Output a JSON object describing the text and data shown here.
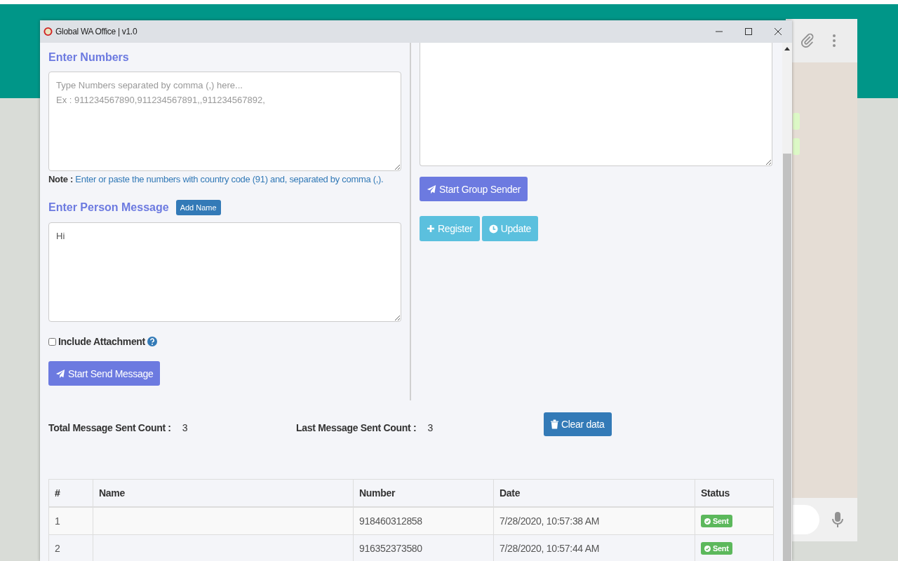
{
  "window": {
    "title": "Global WA Office | v1.0"
  },
  "numbers": {
    "heading": "Enter Numbers",
    "placeholder": "Type Numbers separated by comma (,) here...\nEx : 911234567890,911234567891,,911234567892,",
    "note_label": "Note :",
    "note_text": "Enter or paste the numbers with country code (91) and, separated by comma (,)."
  },
  "message": {
    "heading": "Enter Person Message",
    "add_name_button": "Add Name",
    "value": "Hi"
  },
  "attachment": {
    "label": "Include Attachment",
    "checked": false
  },
  "send_button": "Start Send Message",
  "group_sender_button": "Start Group Sender",
  "register_button": "Register",
  "update_button": "Update",
  "counts": [
    {
      "label": "Total Message Sent Count :",
      "value": "3"
    },
    {
      "label": "Last Message Sent Count :",
      "value": "3"
    }
  ],
  "clear_button": "Clear data",
  "table": {
    "columns": [
      "#",
      "Name",
      "Number",
      "Date",
      "Status"
    ],
    "rows": [
      {
        "index": "1",
        "name": "",
        "number": "918460312858",
        "date": "7/28/2020, 10:57:38 AM",
        "status": "Sent"
      },
      {
        "index": "2",
        "name": "",
        "number": "916352373580",
        "date": "7/28/2020, 10:57:44 AM",
        "status": "Sent"
      }
    ]
  }
}
